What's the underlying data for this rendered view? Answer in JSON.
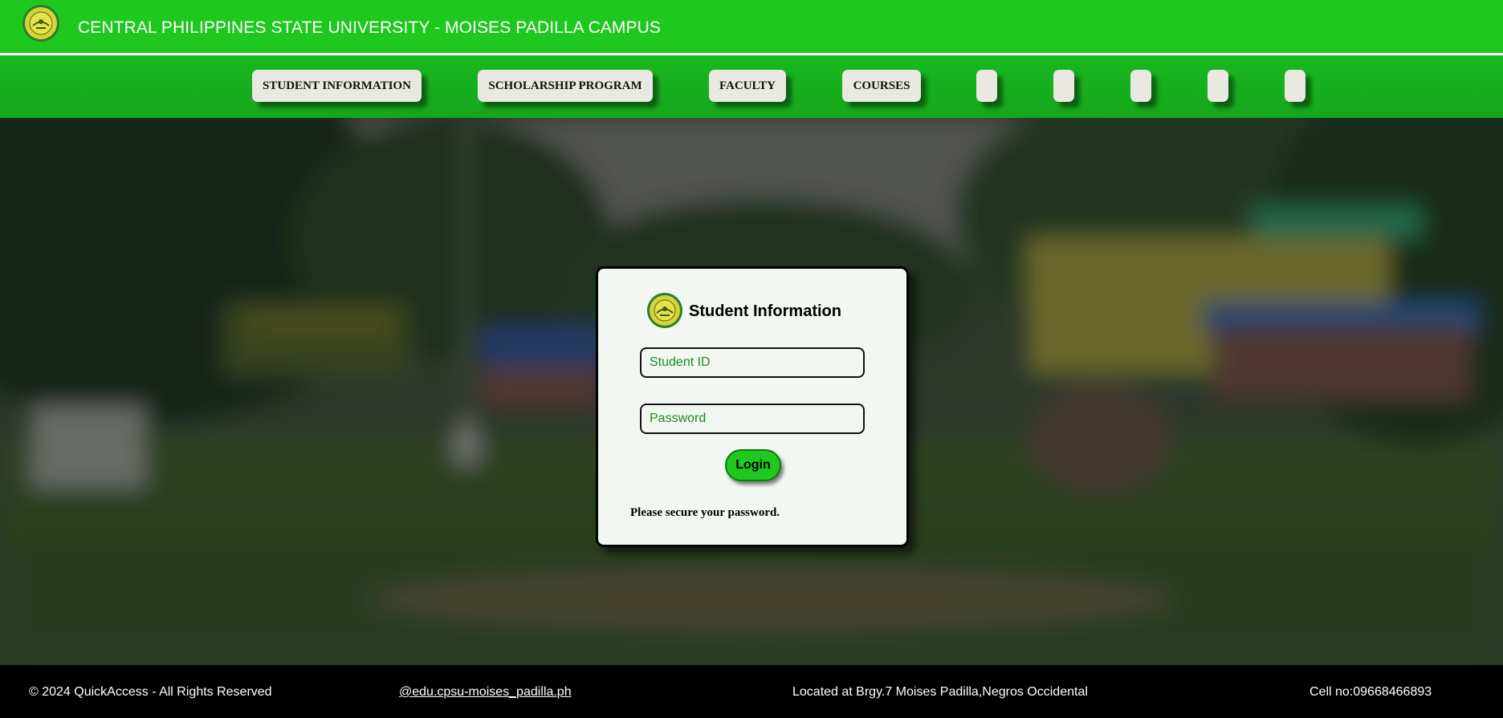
{
  "header": {
    "title": "CENTRAL PHILIPPINES STATE UNIVERSITY - MOISES PADILLA CAMPUS",
    "logo_icon": "university-seal-icon"
  },
  "nav": {
    "items": [
      {
        "label": "STUDENT INFORMATION"
      },
      {
        "label": "SCHOLARSHIP PROGRAM"
      },
      {
        "label": "FACULTY"
      },
      {
        "label": "COURSES"
      },
      {
        "label": ""
      },
      {
        "label": ""
      },
      {
        "label": ""
      },
      {
        "label": ""
      },
      {
        "label": ""
      }
    ]
  },
  "login": {
    "title": "Student Information",
    "student_id_placeholder": "Student ID",
    "password_placeholder": "Password",
    "button_label": "Login",
    "note": "Please secure your password."
  },
  "footer": {
    "copyright": "© 2024 QuickAccess - All Rights Reserved",
    "social_link": "@edu.cpsu-moises_padilla.ph",
    "location": "Located at Brgy.7 Moises Padilla,Negros Occidental",
    "phone": "Cell no:09668466893"
  },
  "colors": {
    "brand_green": "#1ec81e",
    "nav_button": "#e9e9e2",
    "footer_bg": "#000000",
    "card_bg": "#f2f7f2",
    "input_text": "#1a8a1a"
  }
}
